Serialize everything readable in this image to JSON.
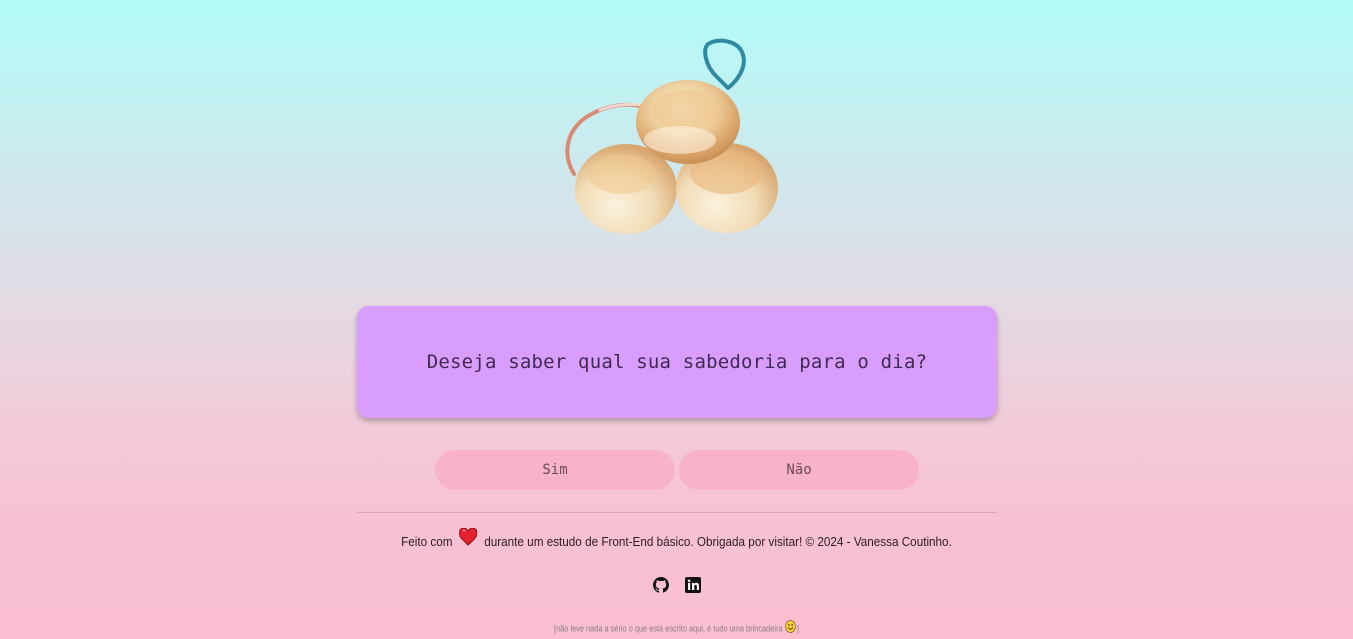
{
  "hero": {
    "icon": "cheese-bread-icon"
  },
  "card": {
    "question": "Deseja saber qual sua sabedoria para o dia?"
  },
  "buttons": {
    "yes_label": "Sim",
    "no_label": "Não"
  },
  "footer": {
    "made_with": "Feito com",
    "heart_icon": "heart-icon",
    "message": "durante um estudo de Front-End básico. Obrigada por visitar! © 2024 - Vanessa Coutinho.",
    "social": [
      {
        "icon": "github-icon"
      },
      {
        "icon": "linkedin-icon"
      }
    ],
    "disclaimer_prefix": "[não leve nada a sério o que está escrito aqui, é tudo uma brincadeira",
    "disclaimer_icon": "smiley-icon",
    "disclaimer_suffix": "]"
  },
  "colors": {
    "card_bg": "#d99dfd",
    "button_bg": "#f8b3cb",
    "gradient_top": "#b2fcf8",
    "gradient_bottom": "#fac0d2"
  }
}
